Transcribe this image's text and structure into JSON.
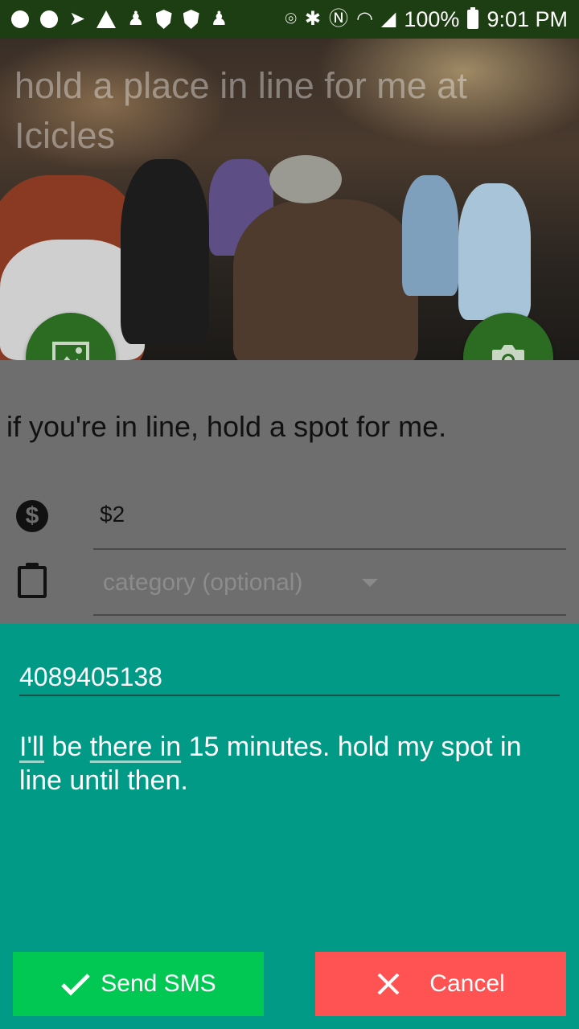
{
  "status_bar": {
    "battery": "100%",
    "time": "9:01 PM",
    "left_icons": [
      "message-icon",
      "fire-icon",
      "send-icon",
      "warning-icon",
      "chess-icon",
      "shield-icon",
      "shield-icon",
      "chess-icon"
    ],
    "right_icons": [
      "location-icon",
      "bluetooth-icon",
      "nfc-icon",
      "wifi-icon",
      "signal-icon",
      "battery-icon"
    ]
  },
  "hero": {
    "title": "hold a place in line for me at Icicles"
  },
  "form": {
    "description": "if you're in line, hold a spot for me.",
    "price": "$2",
    "category_placeholder": "category (optional)"
  },
  "sms": {
    "phone": "4089405138",
    "message_parts": [
      "I'll",
      " be ",
      "there in",
      " 15 minutes.  hold my spot in line until then."
    ],
    "send_label": "Send SMS",
    "cancel_label": "Cancel"
  },
  "colors": {
    "status_bar": "#1d3d12",
    "fab": "#2c6b22",
    "sheet": "#009a87",
    "send": "#00c853",
    "cancel": "#ff5252"
  }
}
